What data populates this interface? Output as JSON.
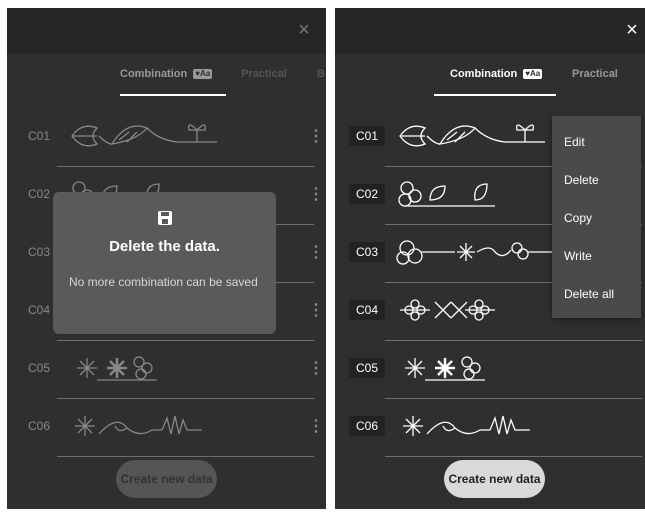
{
  "left_panel": {
    "close_icon": "×",
    "tabs": [
      {
        "label": "Combination",
        "badge": "Aa",
        "state": "active"
      },
      {
        "label": "Practical",
        "state": "inactive"
      },
      {
        "label": "B",
        "state": "inactive"
      }
    ],
    "rows": [
      {
        "code": "C01",
        "motif": "leaf-vine-sprout"
      },
      {
        "code": "C02",
        "motif": "flower-leaf"
      },
      {
        "code": "C03",
        "motif": "flower-vine"
      },
      {
        "code": "C04",
        "motif": "flower-cross"
      },
      {
        "code": "C05",
        "motif": "stars-flower"
      },
      {
        "code": "C06",
        "motif": "snowflake-swirl-heart"
      }
    ],
    "dialog": {
      "icon": "save-icon",
      "title": "Delete the data.",
      "message": "No more combination can be saved"
    },
    "create_button": "Create new data"
  },
  "right_panel": {
    "close_icon": "×",
    "tabs": [
      {
        "label": "Combination",
        "badge": "Aa",
        "state": "active"
      },
      {
        "label": "Practical",
        "state": "inactive"
      }
    ],
    "rows": [
      {
        "code": "C01",
        "motif": "leaf-vine-sprout"
      },
      {
        "code": "C02",
        "motif": "flower-leaf"
      },
      {
        "code": "C03",
        "motif": "flower-vine"
      },
      {
        "code": "C04",
        "motif": "flower-cross"
      },
      {
        "code": "C05",
        "motif": "stars-flower"
      },
      {
        "code": "C06",
        "motif": "snowflake-swirl-heart"
      }
    ],
    "menu": [
      "Edit",
      "Delete",
      "Copy",
      "Write",
      "Delete all"
    ],
    "create_button": "Create new data"
  },
  "colors": {
    "background": "#2f2f2f",
    "dialog": "#5a5a5a",
    "menu": "#4a4a4a",
    "button": "#d9d9d9"
  }
}
